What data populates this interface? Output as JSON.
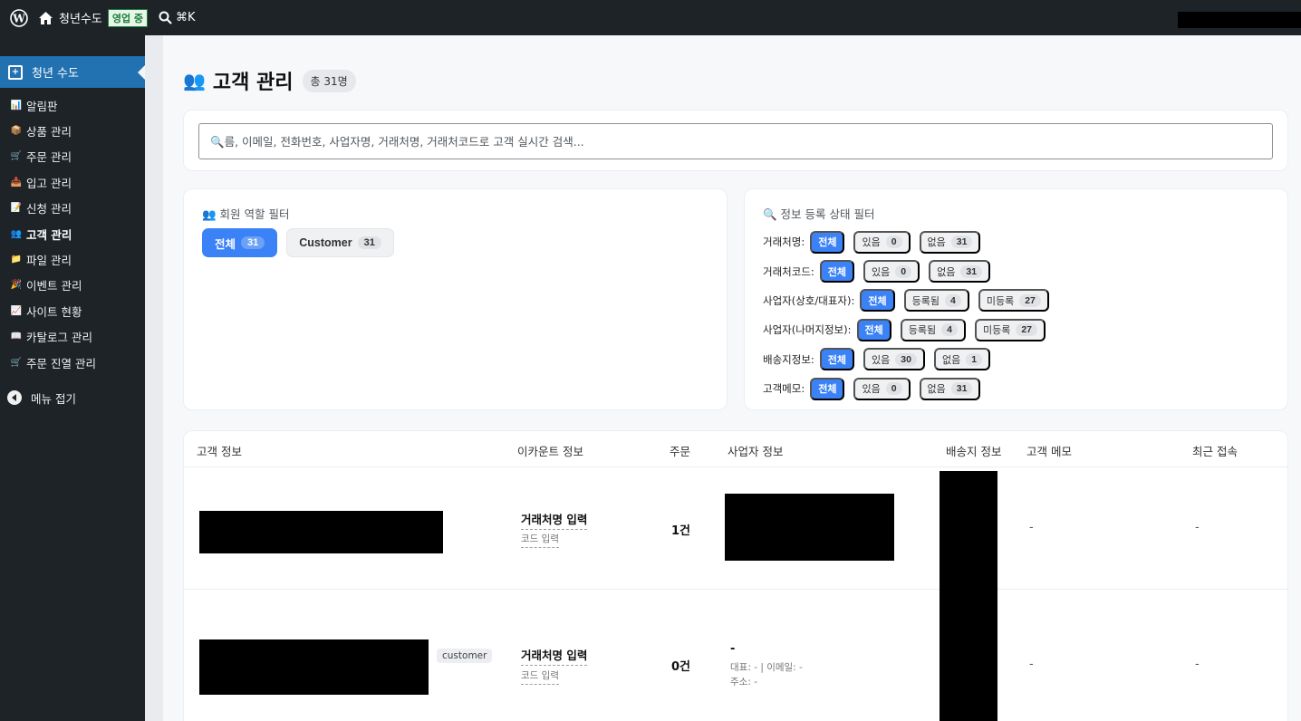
{
  "adminbar": {
    "site_name": "청년수도",
    "live_label": "영업 중",
    "shortcut": "⌘K"
  },
  "sidebar": {
    "brand": "청년 수도",
    "items": [
      {
        "icon": "📊",
        "icon_name": "chart-icon",
        "label": "알림판"
      },
      {
        "icon": "📦",
        "icon_name": "box-icon",
        "label": "상품 관리"
      },
      {
        "icon": "🛒",
        "icon_name": "cart-icon",
        "label": "주문 관리"
      },
      {
        "icon": "📥",
        "icon_name": "inbox-icon",
        "label": "입고 관리"
      },
      {
        "icon": "📝",
        "icon_name": "memo-icon",
        "label": "신청 관리"
      },
      {
        "icon": "👥",
        "icon_name": "users-icon",
        "label": "고객 관리",
        "current": true
      },
      {
        "icon": "📁",
        "icon_name": "folder-icon",
        "label": "파일 관리"
      },
      {
        "icon": "🎉",
        "icon_name": "party-icon",
        "label": "이벤트 관리"
      },
      {
        "icon": "📈",
        "icon_name": "trend-icon",
        "label": "사이트 현황"
      },
      {
        "icon": "📖",
        "icon_name": "book-icon",
        "label": "카탈로그 관리"
      },
      {
        "icon": "🛒",
        "icon_name": "cart-icon",
        "label": "주문 진열 관리"
      }
    ],
    "collapse_label": "메뉴 접기"
  },
  "page": {
    "title_icon": "👥",
    "title": "고객 관리",
    "total": "총 31명"
  },
  "search": {
    "placeholder": "🔍름, 이메일, 전화번호, 사업자명, 거래처명, 거래처코드로 고객 실시간 검색..."
  },
  "role_filter": {
    "title": "👥 회원 역할 필터",
    "options": [
      {
        "label": "전체",
        "count": "31",
        "active": true
      },
      {
        "label": "Customer",
        "count": "31",
        "active": false
      }
    ]
  },
  "status_filter": {
    "title": "🔍 정보 등록 상태 필터",
    "rows": [
      {
        "label": "거래처명:",
        "all": "전체",
        "opts": [
          {
            "label": "있음",
            "count": "0"
          },
          {
            "label": "없음",
            "count": "31"
          }
        ]
      },
      {
        "label": "거래처코드:",
        "all": "전체",
        "opts": [
          {
            "label": "있음",
            "count": "0"
          },
          {
            "label": "없음",
            "count": "31"
          }
        ]
      },
      {
        "label": "사업자(상호/대표자):",
        "all": "전체",
        "opts": [
          {
            "label": "등록됨",
            "count": "4"
          },
          {
            "label": "미등록",
            "count": "27"
          }
        ]
      },
      {
        "label": "사업자(나머지정보):",
        "all": "전체",
        "opts": [
          {
            "label": "등록됨",
            "count": "4"
          },
          {
            "label": "미등록",
            "count": "27"
          }
        ]
      },
      {
        "label": "배송지정보:",
        "all": "전체",
        "opts": [
          {
            "label": "있음",
            "count": "30"
          },
          {
            "label": "없음",
            "count": "1"
          }
        ]
      },
      {
        "label": "고객메모:",
        "all": "전체",
        "opts": [
          {
            "label": "있음",
            "count": "0"
          },
          {
            "label": "없음",
            "count": "31"
          }
        ]
      }
    ]
  },
  "table": {
    "headers": {
      "customer": "고객 정보",
      "ecount": "이카운트 정보",
      "orders": "주문",
      "business": "사업자 정보",
      "shipping": "배송지 정보",
      "memo": "고객 메모",
      "last": "최근 접속"
    },
    "rows": [
      {
        "acct_name": "거래처명 입력",
        "acct_code": "코드 입력",
        "orders": "1건",
        "memo": "-",
        "last": "-"
      },
      {
        "role": "customer",
        "acct_name": "거래처명 입력",
        "acct_code": "코드 입력",
        "orders": "0건",
        "biz_name": "-",
        "biz_rep": "대표: - | 이메일: -",
        "biz_addr": "주소: -",
        "memo": "-",
        "last": "-"
      }
    ]
  }
}
